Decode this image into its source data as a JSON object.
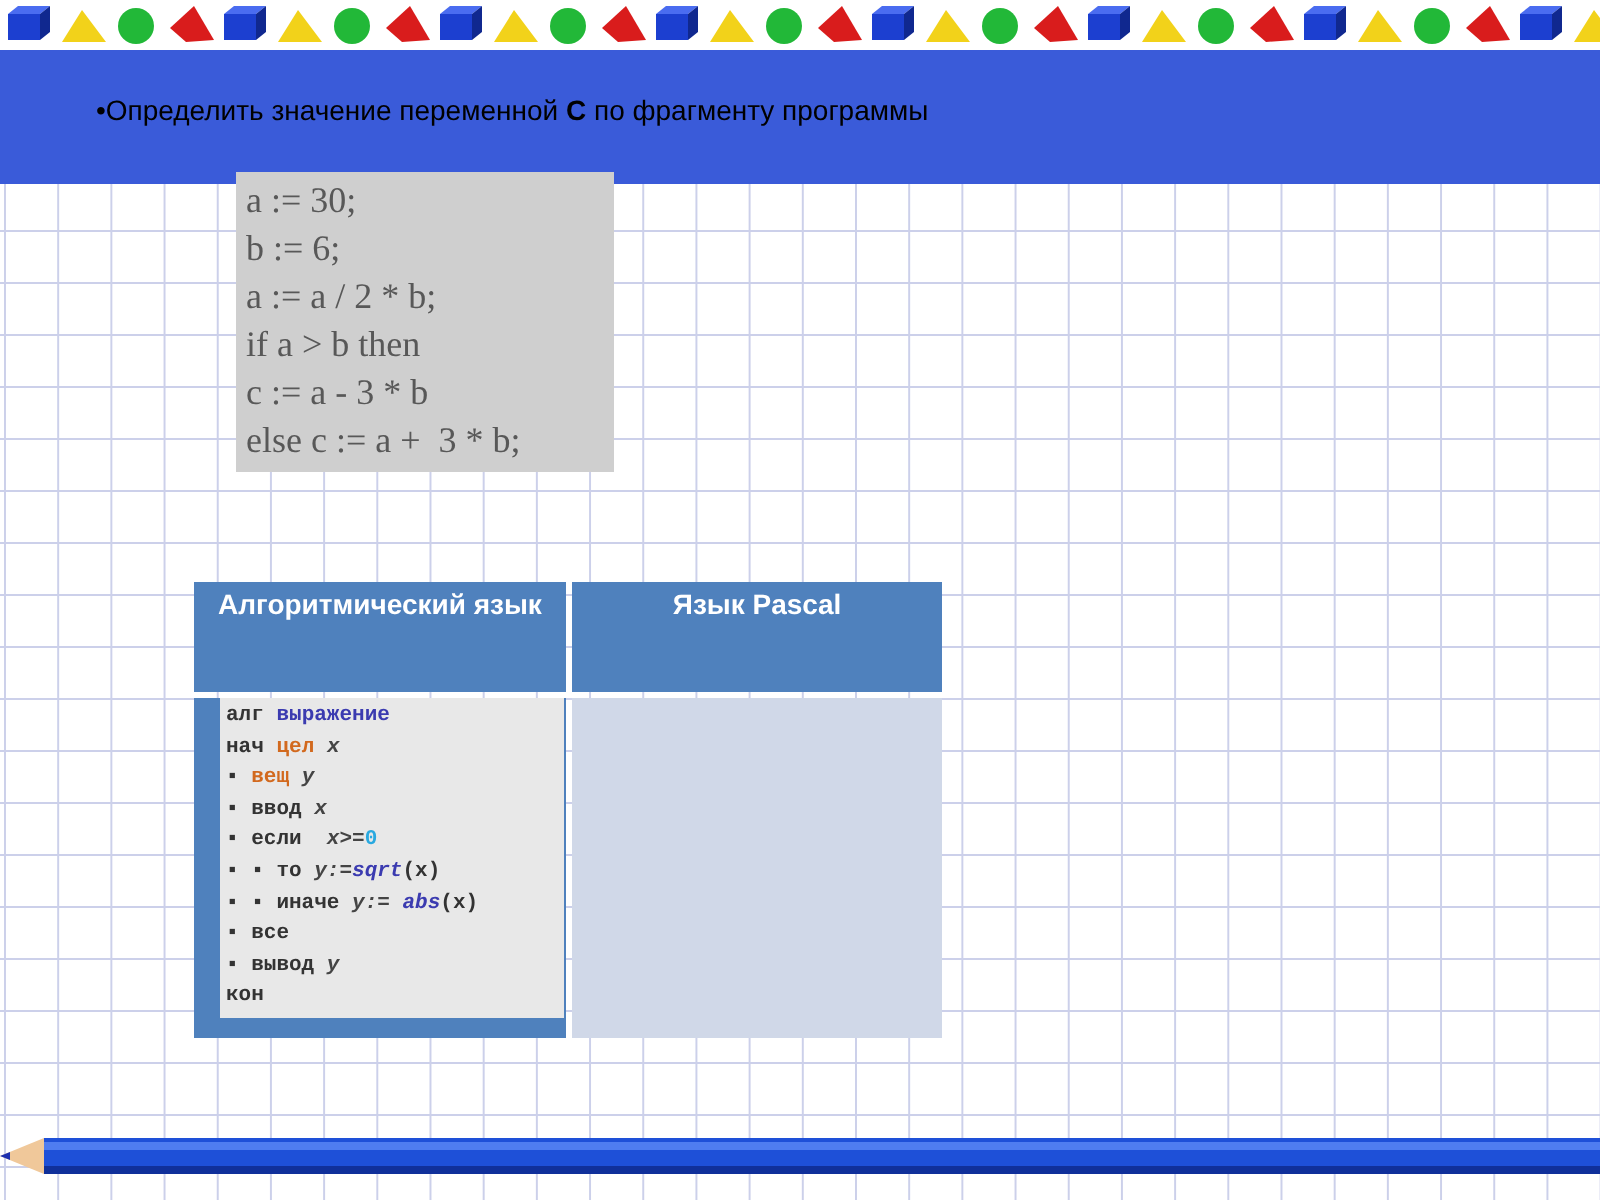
{
  "heading": "•Определить значение переменной **C** по фрагменту программы",
  "pascal_code": [
    "a := 30;",
    "b := 6;",
    "a := a / 2 * b;",
    "if a > b then",
    "c := a - 3 * b",
    "else c := a +  3 * b;"
  ],
  "table": {
    "columns": [
      "Алгоритмический язык",
      "Язык Pascal"
    ],
    "alg_code": [
      [
        {
          "text": "алг ",
          "kind": "kw"
        },
        {
          "text": "выражение",
          "kind": "name"
        }
      ],
      [
        {
          "text": "нач ",
          "kind": "kw"
        },
        {
          "text": "цел ",
          "kind": "type"
        },
        {
          "text": "x",
          "kind": "var"
        }
      ],
      [
        {
          "text": "▪ ",
          "kind": "kw"
        },
        {
          "text": "вещ ",
          "kind": "type"
        },
        {
          "text": "y",
          "kind": "var"
        }
      ],
      [
        {
          "text": "▪ ввод ",
          "kind": "kw"
        },
        {
          "text": "x",
          "kind": "var"
        }
      ],
      [
        {
          "text": "▪ если  ",
          "kind": "kw"
        },
        {
          "text": "x>=",
          "kind": "var"
        },
        {
          "text": "0",
          "kind": "num"
        }
      ],
      [
        {
          "text": "▪ ▪ то ",
          "kind": "kw"
        },
        {
          "text": "y:=",
          "kind": "var"
        },
        {
          "text": "sqrt",
          "kind": "func"
        },
        {
          "text": "(x)",
          "kind": "kw"
        }
      ],
      [
        {
          "text": "▪ ▪ иначе ",
          "kind": "kw"
        },
        {
          "text": "y:= ",
          "kind": "var"
        },
        {
          "text": "abs",
          "kind": "func"
        },
        {
          "text": "(x)",
          "kind": "kw"
        }
      ],
      [
        {
          "text": "▪ все",
          "kind": "kw"
        }
      ],
      [
        {
          "text": "▪ вывод ",
          "kind": "kw"
        },
        {
          "text": "y",
          "kind": "var"
        }
      ],
      [
        {
          "text": "кон",
          "kind": "kw"
        }
      ]
    ]
  }
}
